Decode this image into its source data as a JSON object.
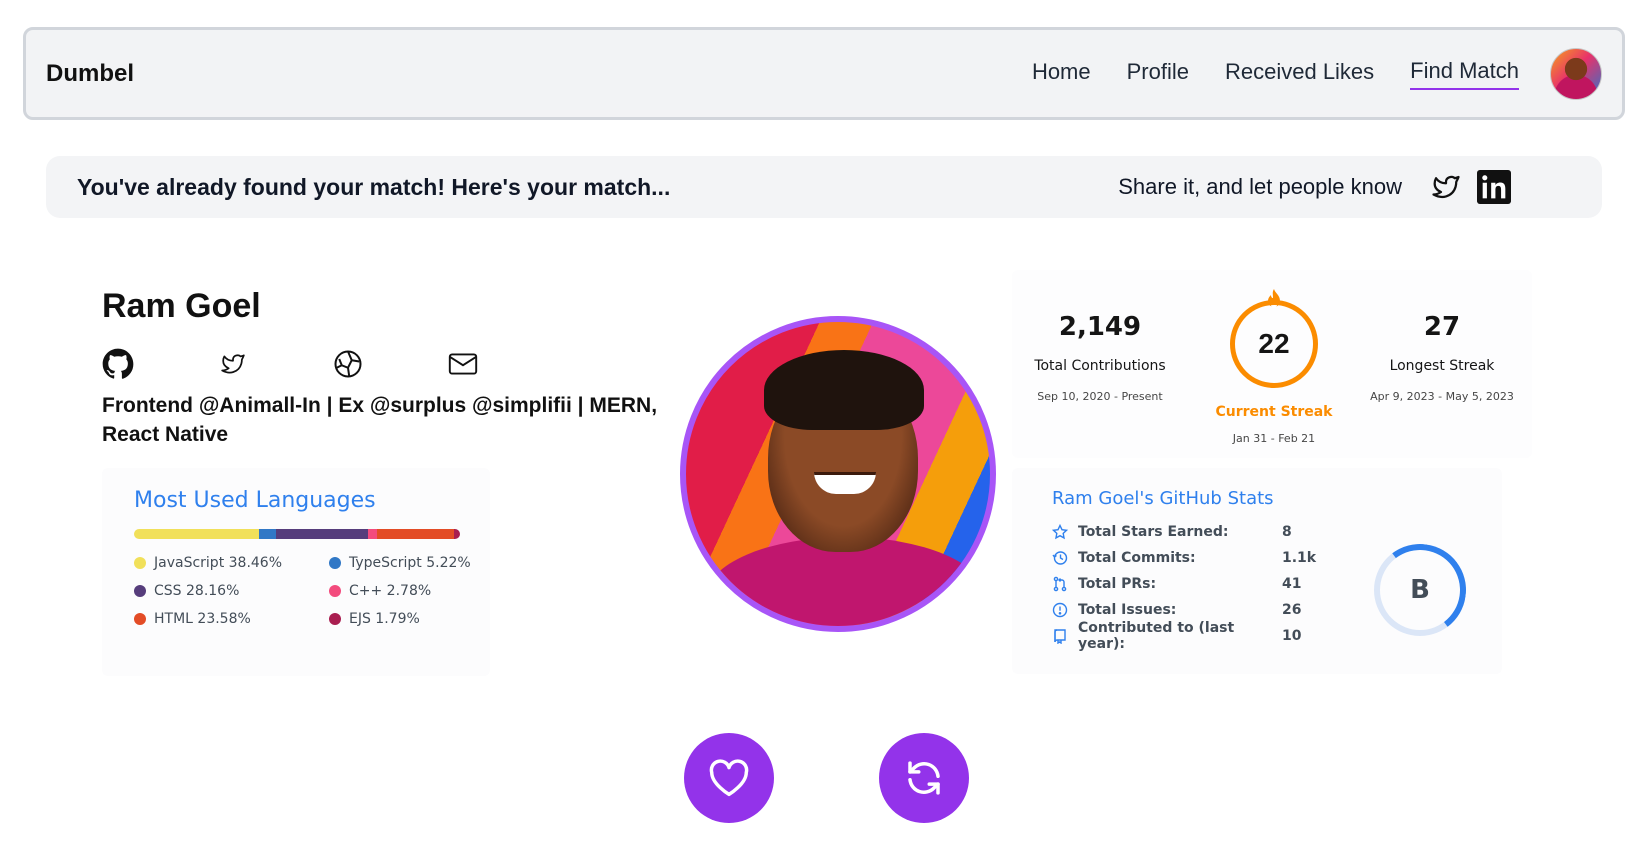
{
  "nav": {
    "brand": "Dumbel",
    "links": [
      "Home",
      "Profile",
      "Received Likes",
      "Find Match"
    ],
    "active": "Find Match"
  },
  "banner": {
    "message": "You've already found your match! Here's your match...",
    "share_text": "Share it, and let people know",
    "icons": [
      "twitter-icon",
      "linkedin-icon"
    ]
  },
  "profile": {
    "name": "Ram Goel",
    "bio": "Frontend @Animall-In | Ex @surplus @simplifii | MERN, React Native",
    "social_icons": [
      "github-icon",
      "twitter-icon",
      "globe-icon",
      "mail-icon"
    ]
  },
  "languages": {
    "title": "Most Used Languages",
    "items": [
      {
        "name": "JavaScript 38.46%",
        "color": "#f1e05a",
        "percent": 38.46
      },
      {
        "name": "TypeScript 5.22%",
        "color": "#3178c6",
        "percent": 5.22
      },
      {
        "name": "CSS 28.16%",
        "color": "#563d7c",
        "percent": 28.16
      },
      {
        "name": "C++ 2.78%",
        "color": "#f34b7d",
        "percent": 2.78
      },
      {
        "name": "HTML 23.58%",
        "color": "#e34c26",
        "percent": 23.58
      },
      {
        "name": "EJS 1.79%",
        "color": "#a91e50",
        "percent": 1.79
      }
    ]
  },
  "streak": {
    "total": "2,149",
    "total_label": "Total Contributions",
    "total_range": "Sep 10, 2020 - Present",
    "current": "22",
    "current_label": "Current Streak",
    "current_range": "Jan 31 - Feb 21",
    "longest": "27",
    "longest_label": "Longest Streak",
    "longest_range": "Apr 9, 2023 - May 5, 2023"
  },
  "github": {
    "title": "Ram Goel's GitHub Stats",
    "rows": [
      {
        "label": "Total Stars Earned:",
        "value": "8"
      },
      {
        "label": "Total Commits:",
        "value": "1.1k"
      },
      {
        "label": "Total PRs:",
        "value": "41"
      },
      {
        "label": "Total Issues:",
        "value": "26"
      },
      {
        "label": "Contributed to (last year):",
        "value": "10"
      }
    ],
    "rank": "B"
  },
  "colors": {
    "accent": "#9333ea",
    "link_blue": "#2f80ed",
    "streak_orange": "#fb8c00"
  }
}
